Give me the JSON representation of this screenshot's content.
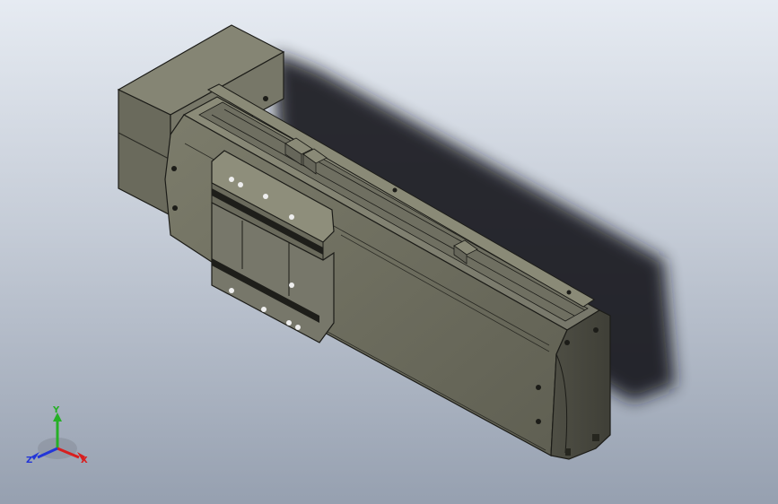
{
  "viewport": {
    "background_top": "#e6ebf2",
    "background_bottom": "#96a0b0"
  },
  "model": {
    "body_color": "#6e6e5f",
    "face_color": "#8b8b78",
    "edge_color": "#1c1c18",
    "highlight_color": "#9a9a87"
  },
  "triad": {
    "x_label": "X",
    "y_label": "Y",
    "z_label": "Z",
    "x_color": "#d81f1f",
    "y_color": "#26b026",
    "z_color": "#2336d8"
  }
}
